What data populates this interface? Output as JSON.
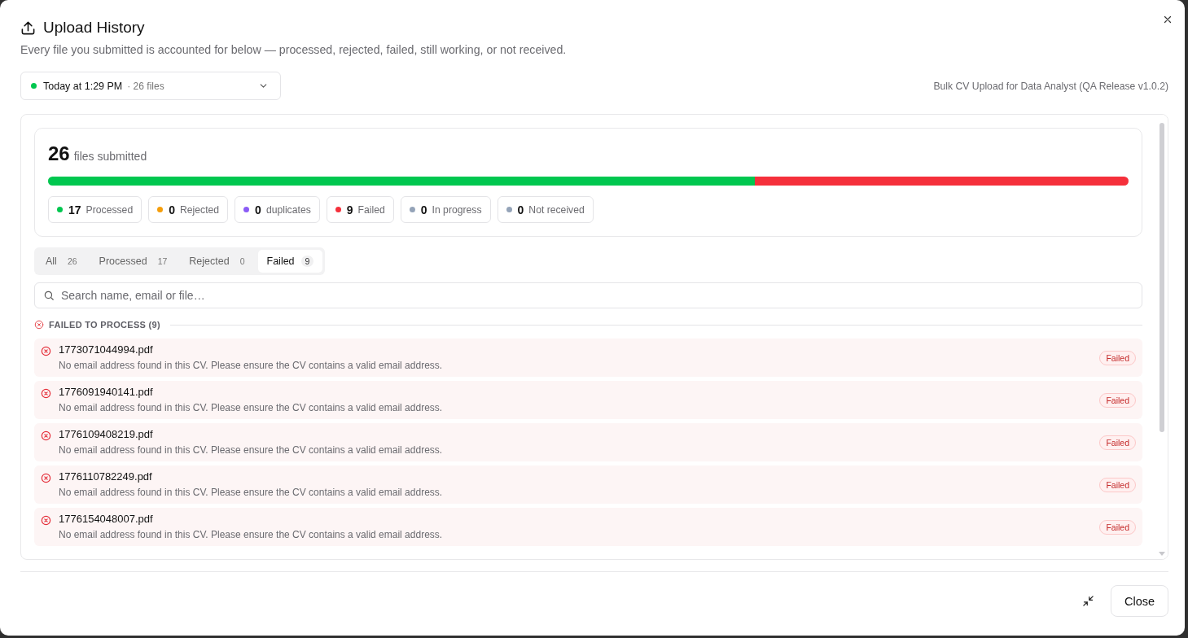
{
  "header": {
    "title": "Upload History",
    "subtitle": "Every file you submitted is accounted for below — processed, rejected, failed, still working, or not received."
  },
  "batch": {
    "value": "Today at 1:29 PM",
    "count": "· 26 files",
    "name": "Bulk CV Upload for Data Analyst (QA Release v1.0.2)"
  },
  "summary": {
    "total": "26",
    "total_label": "files submitted",
    "segments": [
      {
        "level": 0.654,
        "color": "#00c74f"
      },
      {
        "level": 0.346,
        "color": "#f5303b"
      }
    ],
    "stats": [
      {
        "count": "17",
        "label": "Processed",
        "color": "#00c74f"
      },
      {
        "count": "0",
        "label": "Rejected",
        "color": "#f59e0b"
      },
      {
        "count": "0",
        "label": "duplicates",
        "color": "#8b5cf6"
      },
      {
        "count": "9",
        "label": "Failed",
        "color": "#f5303b"
      },
      {
        "count": "0",
        "label": "In progress",
        "color": "#94a3b8"
      },
      {
        "count": "0",
        "label": "Not received",
        "color": "#94a3b8"
      }
    ]
  },
  "tabs": [
    {
      "label": "All",
      "count": "26",
      "selected": false
    },
    {
      "label": "Processed",
      "count": "17",
      "selected": false
    },
    {
      "label": "Rejected",
      "count": "0",
      "selected": false
    },
    {
      "label": "Failed",
      "count": "9",
      "selected": true
    }
  ],
  "search": {
    "placeholder": "Search name, email or file…"
  },
  "section": {
    "title": "FAILED TO PROCESS (9)",
    "rows": [
      {
        "file": "1773071044994.pdf",
        "message": "No email address found in this CV. Please ensure the CV contains a valid email address.",
        "status": "Failed"
      },
      {
        "file": "1776091940141.pdf",
        "message": "No email address found in this CV. Please ensure the CV contains a valid email address.",
        "status": "Failed"
      },
      {
        "file": "1776109408219.pdf",
        "message": "No email address found in this CV. Please ensure the CV contains a valid email address.",
        "status": "Failed"
      },
      {
        "file": "1776110782249.pdf",
        "message": "No email address found in this CV. Please ensure the CV contains a valid email address.",
        "status": "Failed"
      },
      {
        "file": "1776154048007.pdf",
        "message": "No email address found in this CV. Please ensure the CV contains a valid email address.",
        "status": "Failed"
      }
    ]
  },
  "footer": {
    "close_label": "Close"
  }
}
